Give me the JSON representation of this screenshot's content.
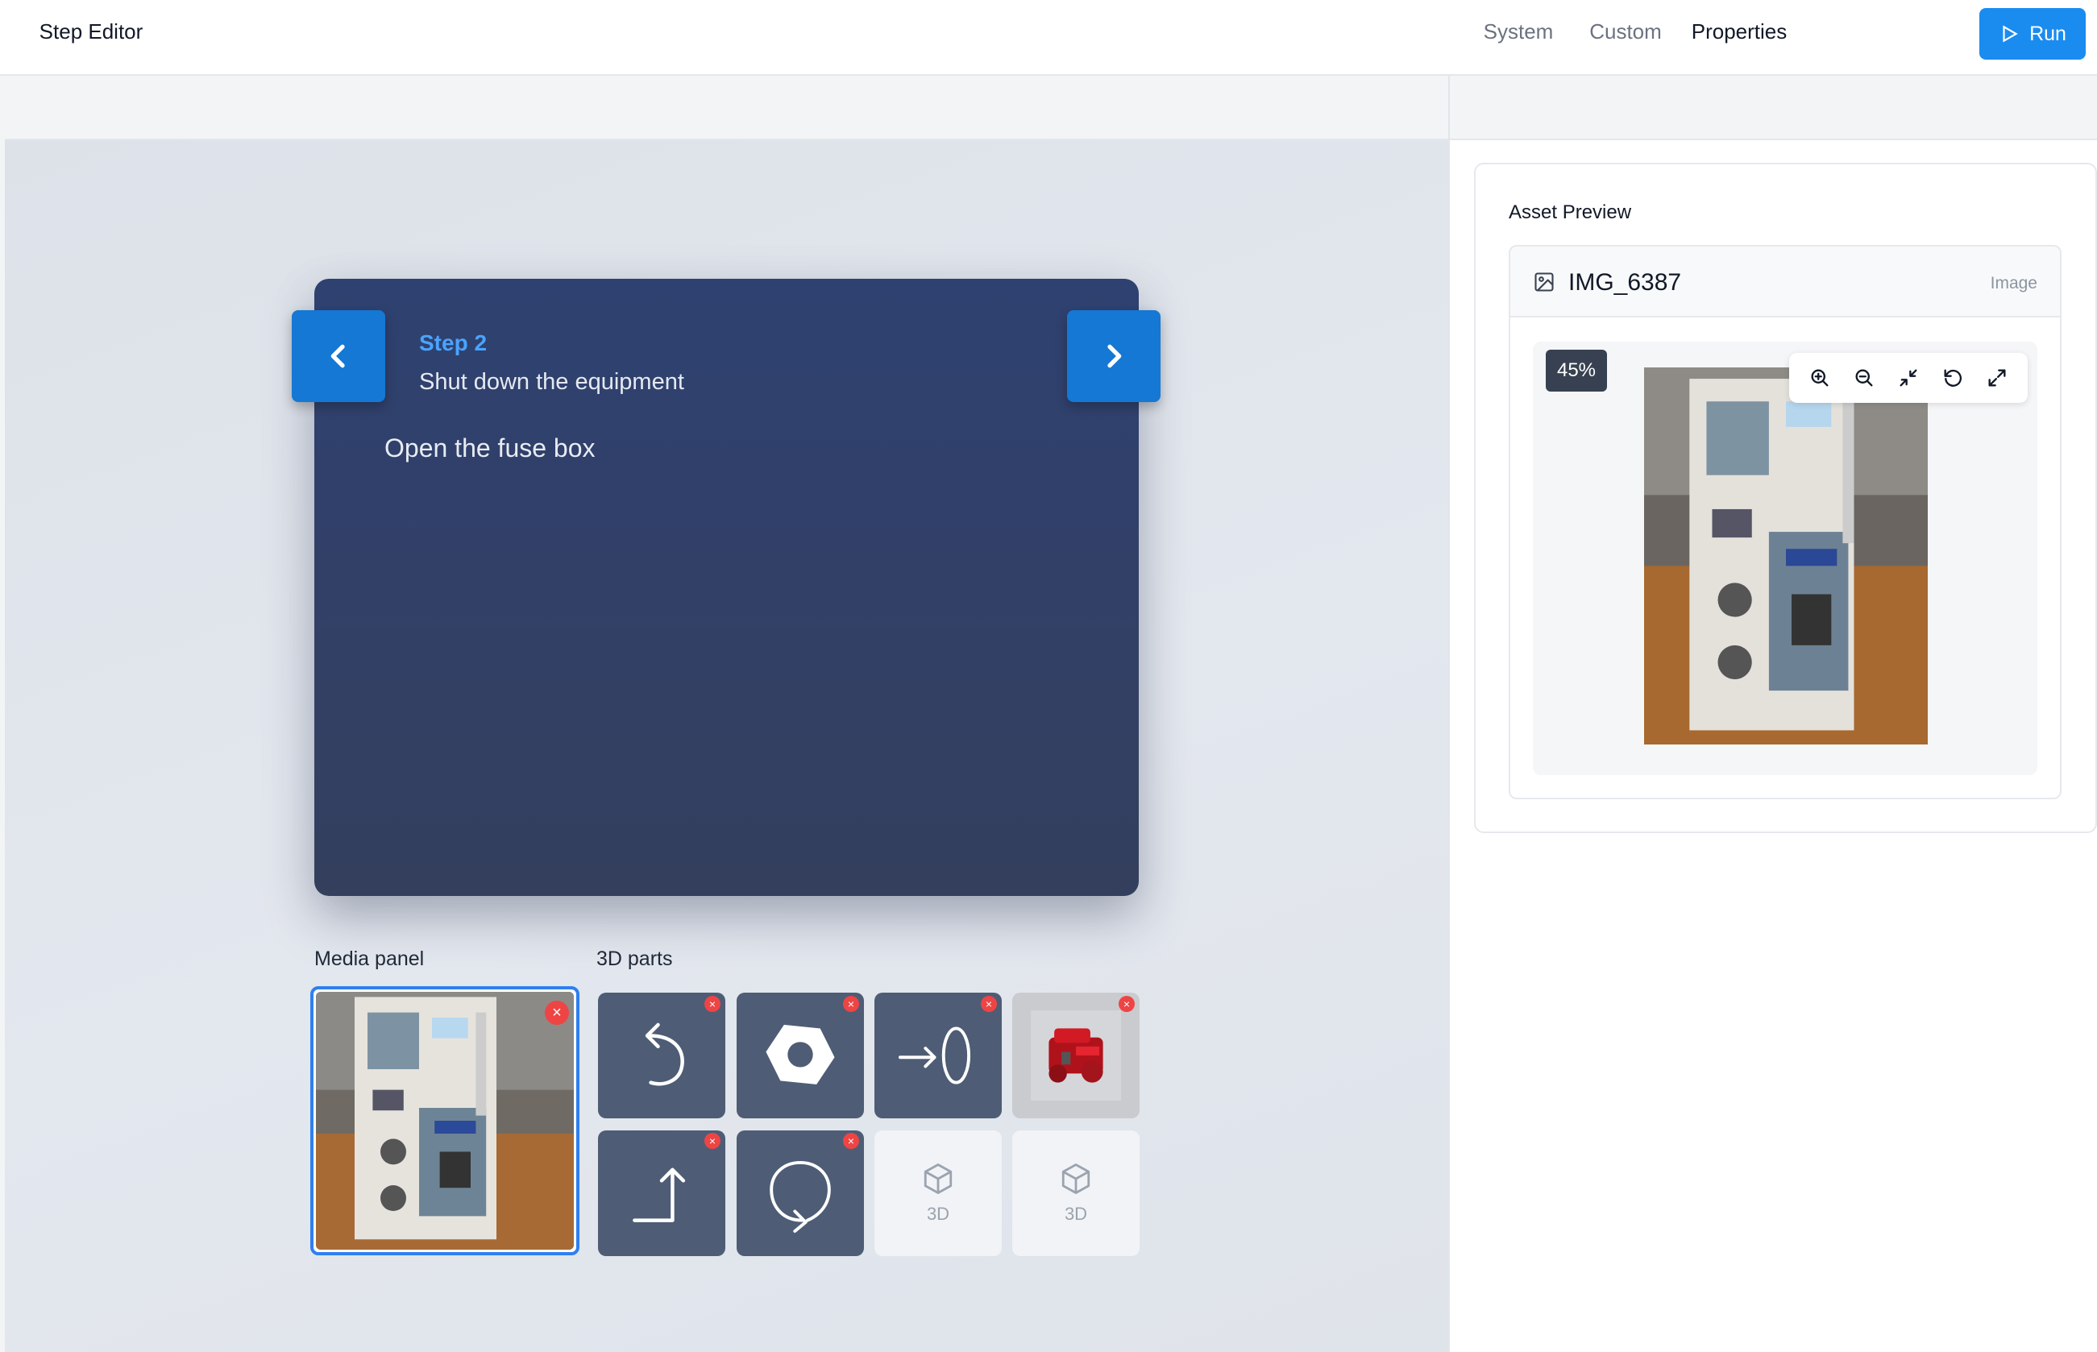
{
  "topbar": {
    "run_label": "Run"
  },
  "left_tabs": {
    "step_editor": "Step Editor"
  },
  "step": {
    "number_label": "Step 2",
    "title": "Shut down the equipment",
    "instruction": "Open the fuse box"
  },
  "media_panel": {
    "label": "Media panel"
  },
  "parts_panel": {
    "label": "3D parts",
    "items": [
      {
        "icon": "undo-arrow-icon",
        "placeholder": ""
      },
      {
        "icon": "hex-nut-icon",
        "placeholder": ""
      },
      {
        "icon": "arrow-to-ring-icon",
        "placeholder": ""
      },
      {
        "icon": "engine-icon",
        "placeholder": ""
      },
      {
        "icon": "up-arrow-icon",
        "placeholder": ""
      },
      {
        "icon": "rotate-arrow-icon",
        "placeholder": ""
      },
      {
        "icon": "cube-icon",
        "placeholder": "3D"
      },
      {
        "icon": "cube-icon",
        "placeholder": "3D"
      }
    ]
  },
  "right_tabs": {
    "system": "System",
    "custom": "Custom",
    "properties": "Properties"
  },
  "asset_preview": {
    "heading": "Asset Preview",
    "name": "IMG_6387",
    "type": "Image",
    "zoom": "45%"
  },
  "colors": {
    "accent": "#1a8cf0",
    "card_bg": "#2e4170",
    "nav_btn": "#1478d4",
    "step_number": "#4aa3ff",
    "delete_badge": "#ef4444"
  }
}
